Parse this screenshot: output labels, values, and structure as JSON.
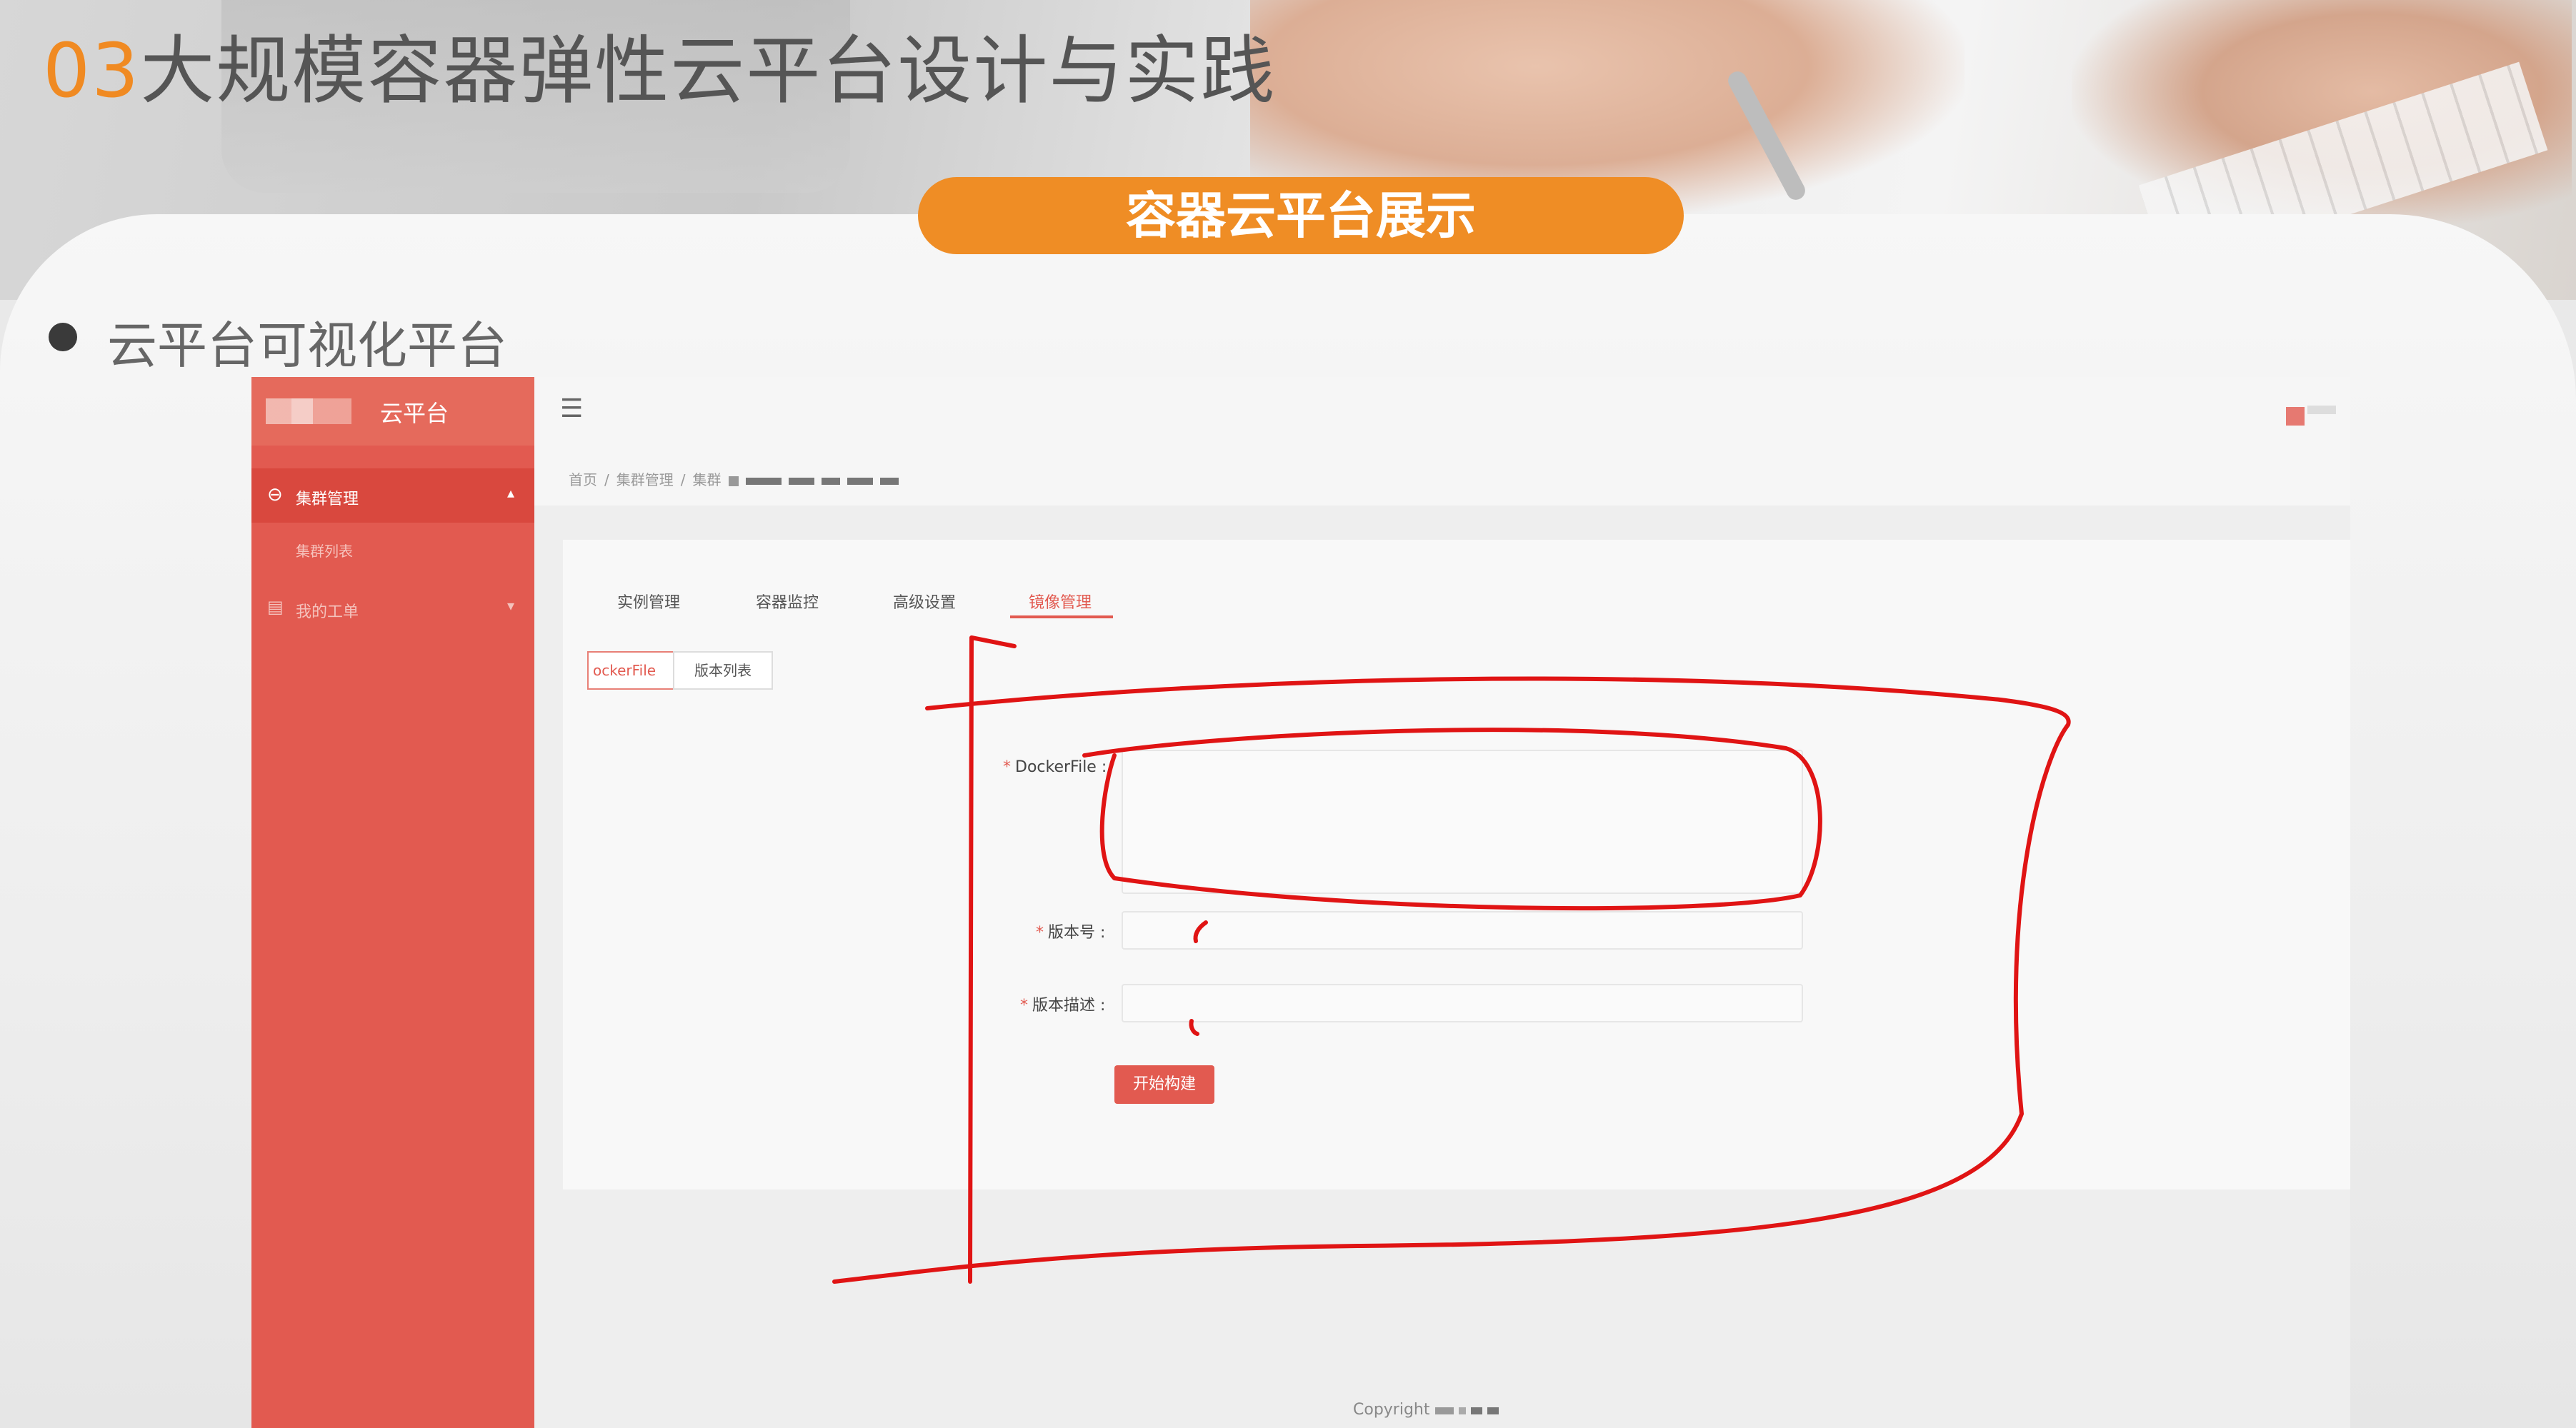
{
  "slide": {
    "section_number": "03",
    "section_title": "大规模容器弹性云平台设计与实践",
    "banner": "容器云平台展示",
    "bullet": "云平台可视化平台",
    "accent_color": "#ef8d25"
  },
  "app": {
    "brand_name": "云平台",
    "sidebar": {
      "group_label": "集群管理",
      "group_icon": "cluster-icon",
      "sub_item": "集群列表",
      "item2_label": "我的工单",
      "item2_icon": "ticket-icon"
    },
    "breadcrumb": [
      "首页",
      "集群管理",
      "集群"
    ],
    "tabs": [
      {
        "label": "实例管理",
        "active": false
      },
      {
        "label": "容器监控",
        "active": false
      },
      {
        "label": "高级设置",
        "active": false
      },
      {
        "label": "镜像管理",
        "active": true
      }
    ],
    "subtabs": [
      {
        "label": "ockerFile",
        "active": true
      },
      {
        "label": "版本列表",
        "active": false
      }
    ],
    "form": {
      "dockerfile_label": "DockerFile :",
      "version_label": "版本号 :",
      "desc_label": "版本描述 :",
      "dockerfile_value": "",
      "version_value": "",
      "desc_value": "",
      "submit_label": "开始构建",
      "required_mark": "*"
    },
    "footer": "Copyright",
    "theme_color": "#e25a50"
  }
}
